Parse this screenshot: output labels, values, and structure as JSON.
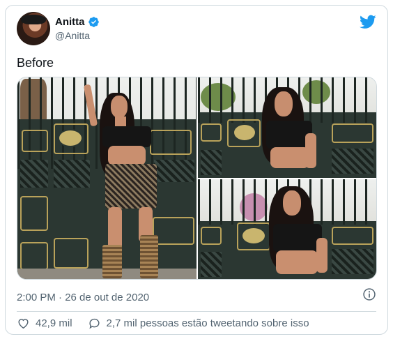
{
  "author": {
    "display_name": "Anitta",
    "handle": "@Anitta",
    "verified": true
  },
  "tweet": {
    "text": "Before",
    "timestamp": "2:00 PM · 26 de out de 2020"
  },
  "stats": {
    "likes": "42,9 mil",
    "tweeting_about": "2,7 mil pessoas estão tweetando sobre isso"
  },
  "icons": {
    "brand": "twitter-bird-icon",
    "verified": "verified-badge-icon",
    "info": "info-icon",
    "like": "heart-icon",
    "reply": "speech-bubble-icon"
  },
  "colors": {
    "brand_blue": "#1d9bf0",
    "secondary_text": "#536471",
    "border": "#cfd9de"
  }
}
